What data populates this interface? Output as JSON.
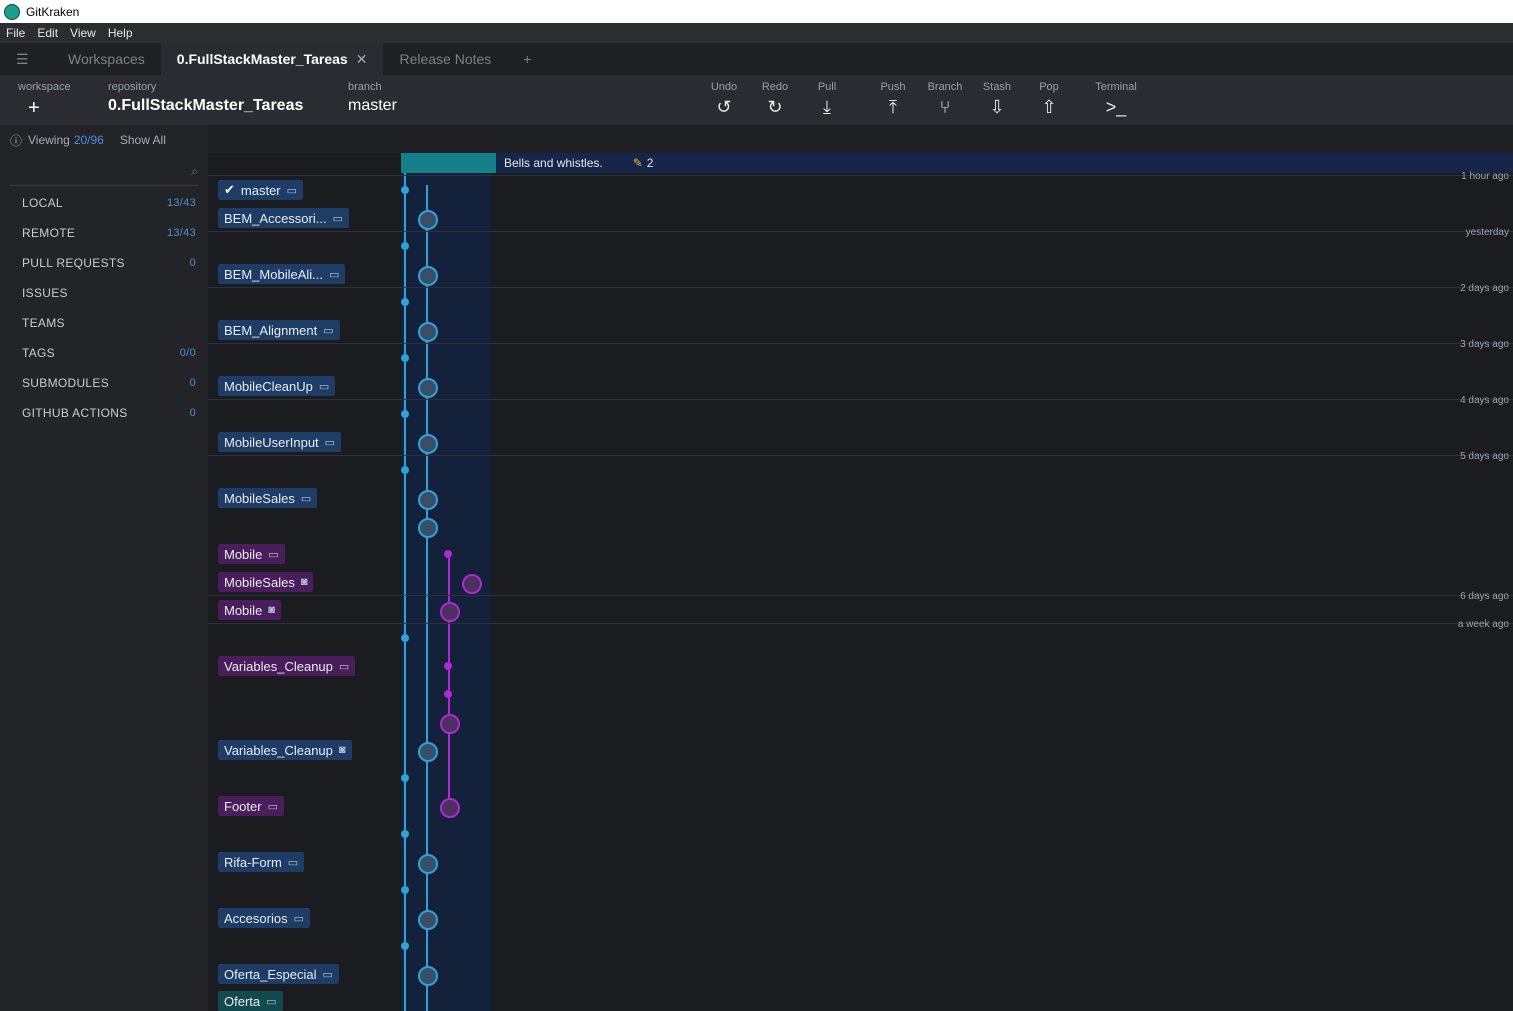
{
  "window": {
    "title": "GitKraken"
  },
  "menu": [
    "File",
    "Edit",
    "View",
    "Help"
  ],
  "tabs": [
    {
      "label": "Workspaces",
      "active": false
    },
    {
      "label": "0.FullStackMaster_Tareas",
      "active": true
    },
    {
      "label": "Release Notes",
      "active": false
    }
  ],
  "toolbar": {
    "workspace_label": "workspace",
    "repository_label": "repository",
    "repository_value": "0.FullStackMaster_Tareas",
    "branch_label": "branch",
    "branch_value": "master",
    "buttons": [
      "Undo",
      "Redo",
      "Pull",
      "Push",
      "Branch",
      "Stash",
      "Pop",
      "Terminal"
    ]
  },
  "sidebar": {
    "viewing_prefix": "Viewing",
    "viewing_count": "20/96",
    "show_all": "Show All",
    "sections": [
      {
        "label": "LOCAL",
        "count": "13/43"
      },
      {
        "label": "REMOTE",
        "count": "13/43"
      },
      {
        "label": "PULL REQUESTS",
        "count": "0"
      },
      {
        "label": "ISSUES",
        "count": ""
      },
      {
        "label": "TEAMS",
        "count": ""
      },
      {
        "label": "TAGS",
        "count": "0/0"
      },
      {
        "label": "SUBMODULES",
        "count": "0"
      },
      {
        "label": "GITHUB ACTIONS",
        "count": "0"
      }
    ]
  },
  "graph": {
    "wip_message": "Bells and whistles.",
    "wip_count": "2",
    "branches": [
      {
        "name": "master",
        "color": "blue",
        "checked": true
      },
      {
        "name": "BEM_Accessori...",
        "color": "blue"
      },
      {
        "name": "BEM_MobileAli...",
        "color": "blue"
      },
      {
        "name": "BEM_Alignment",
        "color": "blue"
      },
      {
        "name": "MobileCleanUp",
        "color": "blue"
      },
      {
        "name": "MobileUserInput",
        "color": "blue"
      },
      {
        "name": "MobileSales",
        "color": "blue"
      },
      {
        "name": "Mobile",
        "color": "purple"
      },
      {
        "name": "MobileSales",
        "color": "purple"
      },
      {
        "name": "Mobile",
        "color": "purple"
      },
      {
        "name": "Variables_Cleanup",
        "color": "purple"
      },
      {
        "name": "Variables_Cleanup",
        "color": "blue"
      },
      {
        "name": "Footer",
        "color": "purple"
      },
      {
        "name": "Rifa-Form",
        "color": "blue"
      },
      {
        "name": "Accesorios",
        "color": "blue"
      },
      {
        "name": "Oferta_Especial",
        "color": "blue"
      },
      {
        "name": "Oferta",
        "color": "teal"
      }
    ],
    "times": [
      "1 hour ago",
      "yesterday",
      "2 days ago",
      "3 days ago",
      "4 days ago",
      "5 days ago",
      "6 days ago",
      "a week ago"
    ]
  },
  "colors": {
    "blue_lane": "#2fa3d8",
    "purple_lane": "#b127d6",
    "wip": "#16808a"
  }
}
